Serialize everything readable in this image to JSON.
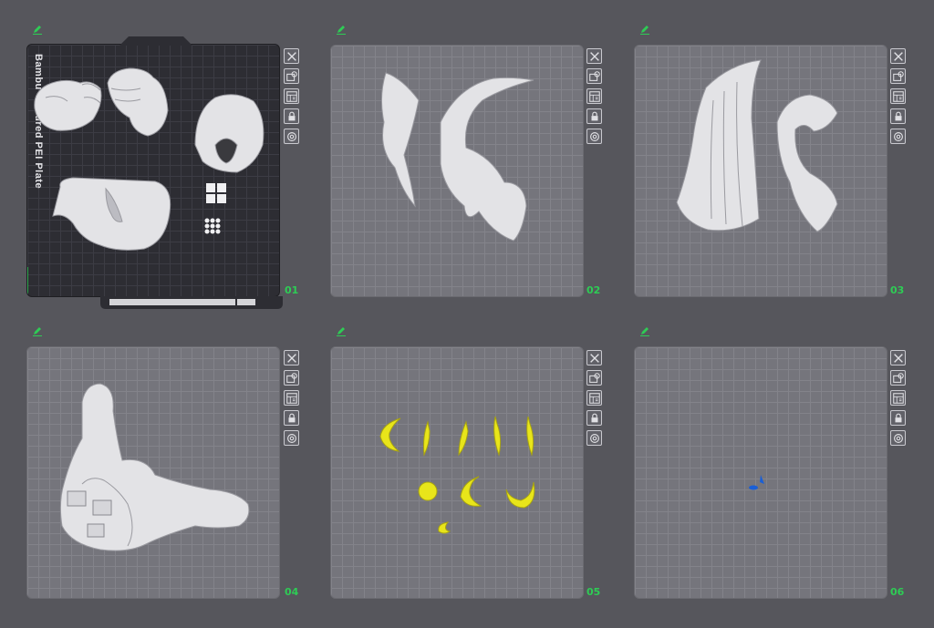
{
  "plates": [
    {
      "number": "01",
      "label": "Bambu Textured PEI Plate"
    },
    {
      "number": "02"
    },
    {
      "number": "03"
    },
    {
      "number": "04"
    },
    {
      "number": "05"
    },
    {
      "number": "06"
    }
  ],
  "toolbar_icons": [
    "close-icon",
    "auto-orient-icon",
    "arrange-icon",
    "lock-icon",
    "settings-icon"
  ],
  "colors": {
    "background": "#56565c",
    "plate": "#75757c",
    "active_plate": "#2d2d33",
    "plate_number": "#2ecc55",
    "model_white": "#e6e6e6",
    "model_yellow": "#e8e51a",
    "model_blue": "#1a5fd6"
  }
}
